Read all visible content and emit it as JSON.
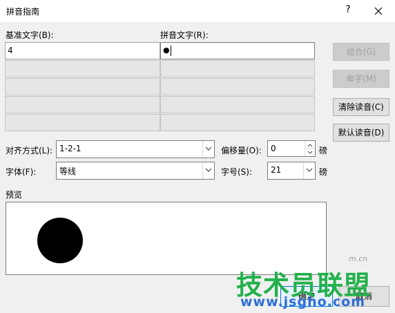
{
  "window": {
    "title": "拼音指南",
    "help_label": "?"
  },
  "columns": {
    "base_label": "基准文字(B):",
    "pinyin_label": "拼音文字(R):"
  },
  "rows": [
    {
      "base": "4",
      "pinyin": "●"
    },
    {
      "base": "",
      "pinyin": ""
    },
    {
      "base": "",
      "pinyin": ""
    },
    {
      "base": "",
      "pinyin": ""
    },
    {
      "base": "",
      "pinyin": ""
    }
  ],
  "buttons": {
    "group": "组合(G)",
    "mono": "单字(M)",
    "clear": "清除读音(C)",
    "default": "默认读音(D)",
    "ok": "确定",
    "cancel": "取消"
  },
  "options": {
    "align_label": "对齐方式(L):",
    "align_value": "1-2-1",
    "offset_label": "偏移量(O):",
    "offset_value": "0",
    "offset_unit": "磅",
    "font_label": "字体(F):",
    "font_value": "等线",
    "size_label": "字号(S):",
    "size_value": "21",
    "size_unit": "磅"
  },
  "preview": {
    "label": "预览"
  },
  "watermark": {
    "text": "技术员联盟",
    "url": "www.jsgho.com",
    "small": "m.cn"
  }
}
